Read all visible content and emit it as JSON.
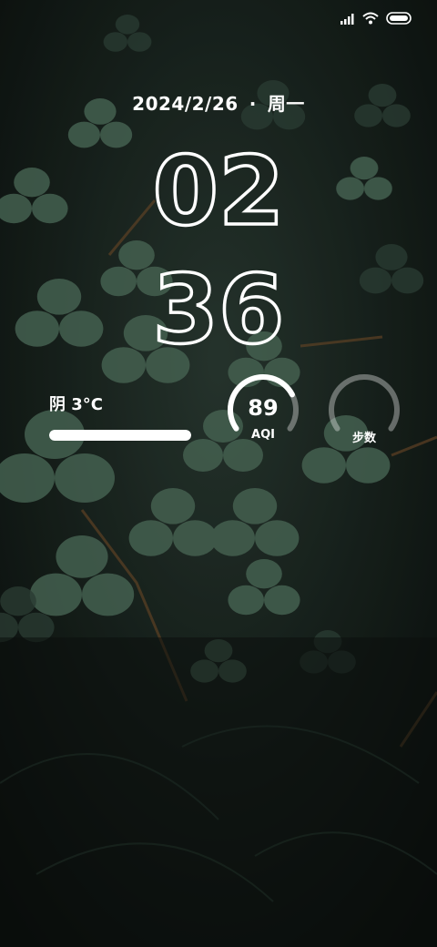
{
  "status_bar": {
    "icons": [
      "signal-icon",
      "wifi-icon",
      "battery-icon"
    ]
  },
  "lockscreen": {
    "date": "2024/2/26",
    "separator": "·",
    "weekday": "周一",
    "clock": {
      "hour": "02",
      "minute": "36"
    }
  },
  "weather": {
    "text": "阴 3°C",
    "bar_fill_fraction": 1.0
  },
  "widgets": {
    "aqi": {
      "value": "89",
      "label": "AQI",
      "level_fraction": 0.75
    },
    "steps": {
      "label": "步数",
      "level_fraction": 0.0
    }
  },
  "colors": {
    "text": "#ffffff",
    "track": "rgba(255,255,255,0.35)"
  }
}
